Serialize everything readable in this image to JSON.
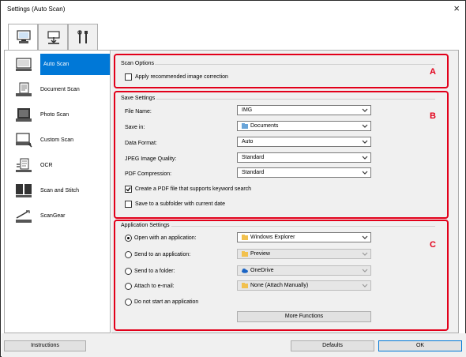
{
  "window": {
    "title": "Settings (Auto Scan)",
    "close_glyph": "×"
  },
  "tabs": [
    {
      "name": "scan-from-computer",
      "icon": "computer-scan-icon",
      "active": true
    },
    {
      "name": "scan-from-panel",
      "icon": "operation-panel-icon",
      "active": false
    },
    {
      "name": "general-settings",
      "icon": "tools-icon",
      "active": false
    }
  ],
  "sidebar": {
    "items": [
      {
        "label": "Auto Scan",
        "icon": "auto-scan-icon",
        "selected": true
      },
      {
        "label": "Document Scan",
        "icon": "document-scan-icon",
        "selected": false
      },
      {
        "label": "Photo Scan",
        "icon": "photo-scan-icon",
        "selected": false
      },
      {
        "label": "Custom Scan",
        "icon": "custom-scan-icon",
        "selected": false
      },
      {
        "label": "OCR",
        "icon": "ocr-icon",
        "selected": false
      },
      {
        "label": "Scan and Stitch",
        "icon": "scan-and-stitch-icon",
        "selected": false
      },
      {
        "label": "ScanGear",
        "icon": "scangear-icon",
        "selected": false
      }
    ]
  },
  "scan_options": {
    "title": "Scan Options",
    "marker": "A",
    "apply_correction": {
      "label": "Apply recommended image correction",
      "checked": false
    }
  },
  "save_settings": {
    "title": "Save Settings",
    "marker": "B",
    "file_name": {
      "label": "File Name:",
      "value": "IMG"
    },
    "save_in": {
      "label": "Save in:",
      "value": "Documents",
      "icon": "folder-documents-icon"
    },
    "data_format": {
      "label": "Data Format:",
      "value": "Auto"
    },
    "jpeg_quality": {
      "label": "JPEG Image Quality:",
      "value": "Standard"
    },
    "pdf_compression": {
      "label": "PDF Compression:",
      "value": "Standard"
    },
    "keyword_search": {
      "label": "Create a PDF file that supports keyword search",
      "checked": true
    },
    "subfolder": {
      "label": "Save to a subfolder with current date",
      "checked": false
    }
  },
  "application_settings": {
    "title": "Application Settings",
    "marker": "C",
    "options": [
      {
        "label": "Open with an application:",
        "value": "Windows Explorer",
        "icon": "explorer-icon",
        "selected": true,
        "enabled": true
      },
      {
        "label": "Send to an application:",
        "value": "Preview",
        "icon": "folder-icon",
        "selected": false,
        "enabled": false
      },
      {
        "label": "Send to a folder:",
        "value": "OneDrive",
        "icon": "onedrive-icon",
        "selected": false,
        "enabled": false
      },
      {
        "label": "Attach to e-mail:",
        "value": "None (Attach Manually)",
        "icon": "folder-icon",
        "selected": false,
        "enabled": false
      },
      {
        "label": "Do not start an application",
        "selected": false
      }
    ],
    "more_functions": "More Functions"
  },
  "footer": {
    "instructions": "Instructions",
    "defaults": "Defaults",
    "ok": "OK"
  },
  "colors": {
    "accent": "#0078d7",
    "marker_red": "#e2001a"
  }
}
